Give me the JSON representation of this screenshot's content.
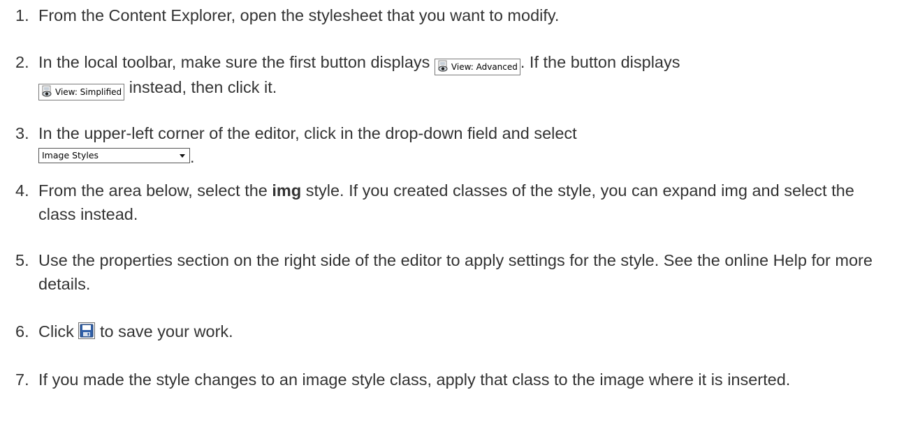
{
  "steps": [
    {
      "num": "1.",
      "text": "From the Content Explorer, open the stylesheet that you want to modify."
    },
    {
      "num": "2.",
      "text_before": "In the local toolbar, make sure the first button displays",
      "button_advanced": "View: Advanced",
      "text_middle": ". If the button displays",
      "button_simplified": "View: Simplified",
      "text_after": "instead, then click it."
    },
    {
      "num": "3.",
      "text_before": "In the upper-left corner of the editor, click in the drop-down field and select",
      "dropdown_value": "Image Styles",
      "text_after": "."
    },
    {
      "num": "4.",
      "text_before": "From the area below, select the",
      "bold_term": "img",
      "text_after": "style. If you created classes of the style, you can expand img and select the class instead."
    },
    {
      "num": "5.",
      "text": "Use the properties section on the right side of the editor to apply settings for the style. See the online Help for more details."
    },
    {
      "num": "6.",
      "text_before": "Click",
      "icon": "save-icon",
      "text_after": "to save your work."
    },
    {
      "num": "7.",
      "text": "If you made the style changes to an image style class, apply that class to the image where it is inserted."
    }
  ]
}
